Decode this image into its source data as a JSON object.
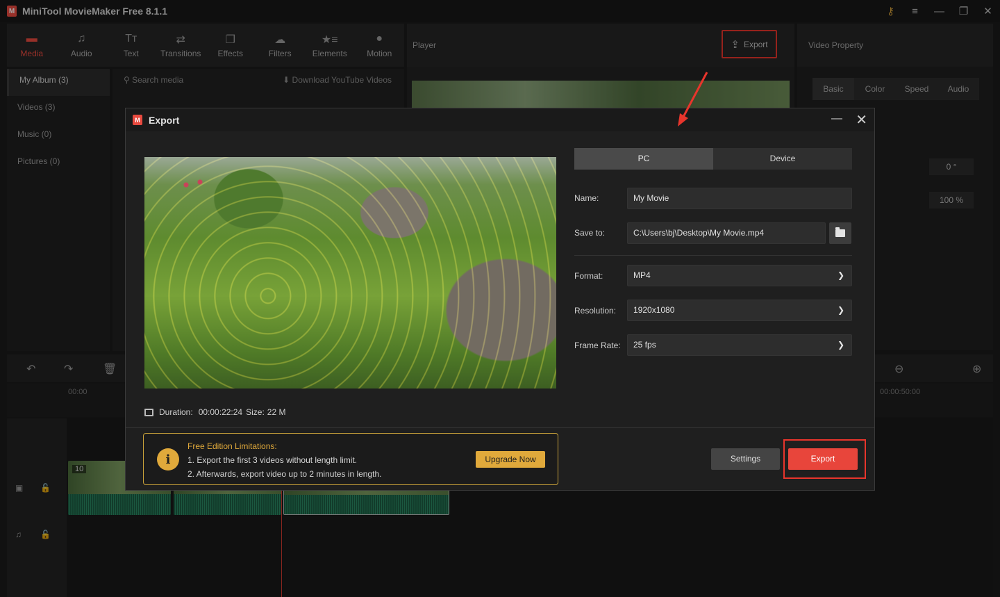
{
  "app": {
    "title": "MiniTool MovieMaker Free 8.1.1"
  },
  "library_tabs": [
    {
      "label": "Media",
      "icon": "media-folder-icon"
    },
    {
      "label": "Audio",
      "icon": "music-note-icon"
    },
    {
      "label": "Text",
      "icon": "text-icon"
    },
    {
      "label": "Transitions",
      "icon": "transitions-icon"
    },
    {
      "label": "Effects",
      "icon": "effects-icon"
    },
    {
      "label": "Filters",
      "icon": "filters-icon"
    },
    {
      "label": "Elements",
      "icon": "elements-icon"
    },
    {
      "label": "Motion",
      "icon": "motion-icon"
    }
  ],
  "sidebar": [
    {
      "label": "My Album (3)"
    },
    {
      "label": "Videos (3)"
    },
    {
      "label": "Music (0)"
    },
    {
      "label": "Pictures (0)"
    }
  ],
  "media": {
    "search_placeholder": "Search media",
    "download_label": "Download YouTube Videos"
  },
  "player": {
    "label": "Player",
    "export_label": "Export"
  },
  "property": {
    "label": "Video Property",
    "tabs": [
      "Basic",
      "Color",
      "Speed",
      "Audio"
    ],
    "rotation_value": "0 °",
    "scale_value": "100 %"
  },
  "timeline": {
    "ruler_start": "00:00",
    "ruler_end": "00:00:50:00",
    "clip_badge": "10"
  },
  "export_dialog": {
    "title": "Export",
    "tabs": {
      "pc": "PC",
      "device": "Device"
    },
    "name_label": "Name:",
    "name_value": "My Movie",
    "save_label": "Save to:",
    "save_value": "C:\\Users\\bj\\Desktop\\My Movie.mp4",
    "format_label": "Format:",
    "format_value": "MP4",
    "resolution_label": "Resolution:",
    "resolution_value": "1920x1080",
    "framerate_label": "Frame Rate:",
    "framerate_value": "25 fps",
    "duration_label": "Duration:",
    "duration_value": "00:00:22:24",
    "size_label": "Size:",
    "size_value": "22 M",
    "notice_title": "Free Edition Limitations:",
    "notice_line1": "1. Export the first 3 videos without length limit.",
    "notice_line2": "2. Afterwards, export video up to 2 minutes in length.",
    "upgrade_label": "Upgrade Now",
    "settings_label": "Settings",
    "export_label": "Export"
  },
  "colors": {
    "accent_red": "#e8453b",
    "highlight_frame": "#e8352c",
    "warning_gold": "#e0a93b"
  }
}
